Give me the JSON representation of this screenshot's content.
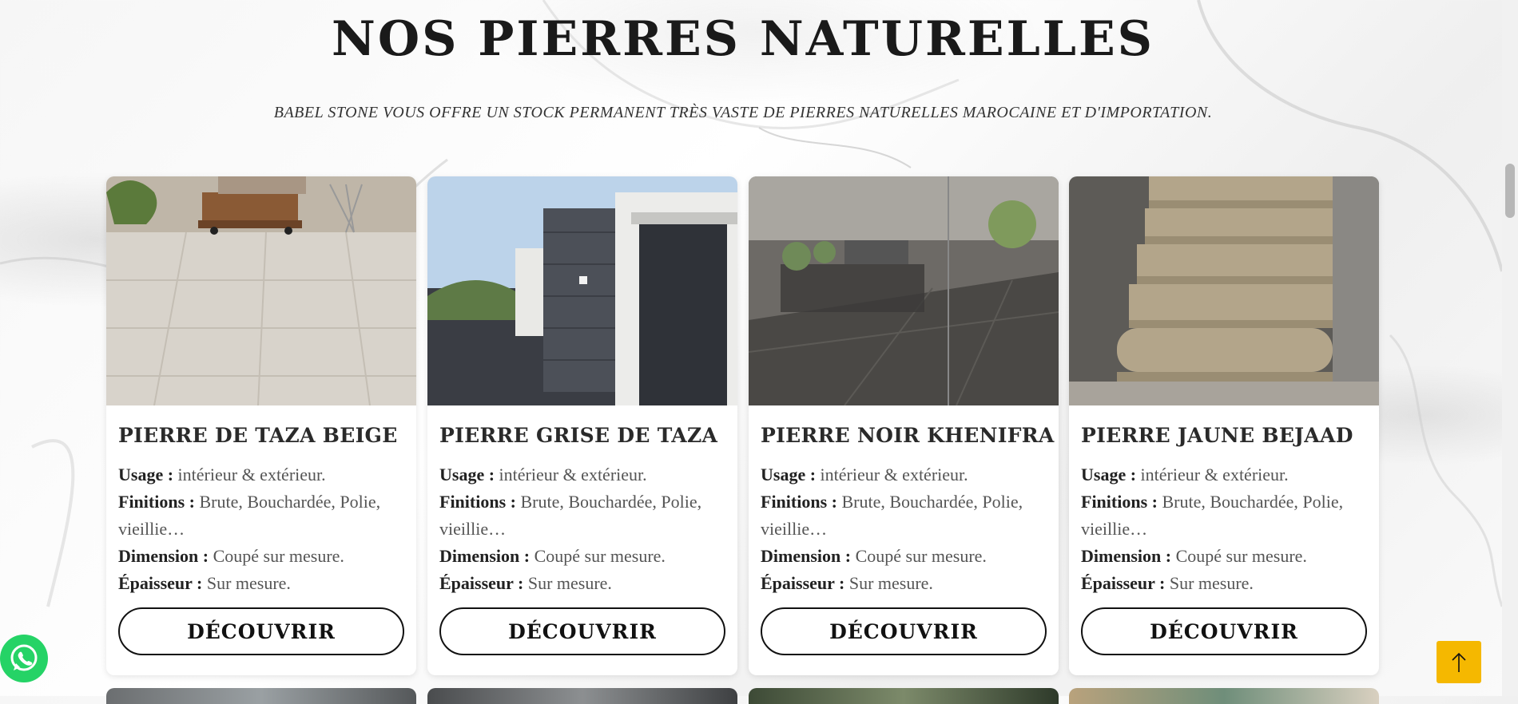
{
  "section": {
    "title": "NOS PIERRES NATURELLES",
    "subtitle": "BABEL STONE VOUS OFFRE UN STOCK PERMANENT TRÈS VASTE DE PIERRES NATURELLES MAROCAINE ET D'IMPORTATION."
  },
  "labels": {
    "usage": "Usage :",
    "finitions": "Finitions :",
    "dimension": "Dimension :",
    "epaisseur": "Épaisseur :"
  },
  "products": [
    {
      "name": "PIERRE DE TAZA BEIGE",
      "usage": "intérieur & extérieur.",
      "finitions": "Brute, Bouchardée, Polie, vieillie…",
      "dimension": "Coupé sur mesure.",
      "epaisseur": "Sur mesure.",
      "button": "DÉCOUVRIR"
    },
    {
      "name": "PIERRE GRISE DE TAZA",
      "usage": "intérieur & extérieur.",
      "finitions": "Brute, Bouchardée, Polie, vieillie…",
      "dimension": "Coupé sur mesure.",
      "epaisseur": "Sur mesure.",
      "button": "DÉCOUVRIR"
    },
    {
      "name": "PIERRE NOIR KHENIFRA",
      "usage": "intérieur & extérieur.",
      "finitions": "Brute, Bouchardée, Polie, vieillie…",
      "dimension": "Coupé sur mesure.",
      "epaisseur": "Sur mesure.",
      "button": "DÉCOUVRIR"
    },
    {
      "name": "PIERRE JAUNE BEJAAD",
      "usage": "intérieur & extérieur.",
      "finitions": "Brute, Bouchardée, Polie, vieillie…",
      "dimension": "Coupé sur mesure.",
      "epaisseur": "Sur mesure.",
      "button": "DÉCOUVRIR"
    }
  ],
  "floating": {
    "whatsapp_icon": "whatsapp-icon",
    "scroll_top_icon": "arrow-up-icon"
  },
  "colors": {
    "whatsapp": "#25d366",
    "scroll_top": "#f5b800",
    "button_border": "#111111"
  }
}
